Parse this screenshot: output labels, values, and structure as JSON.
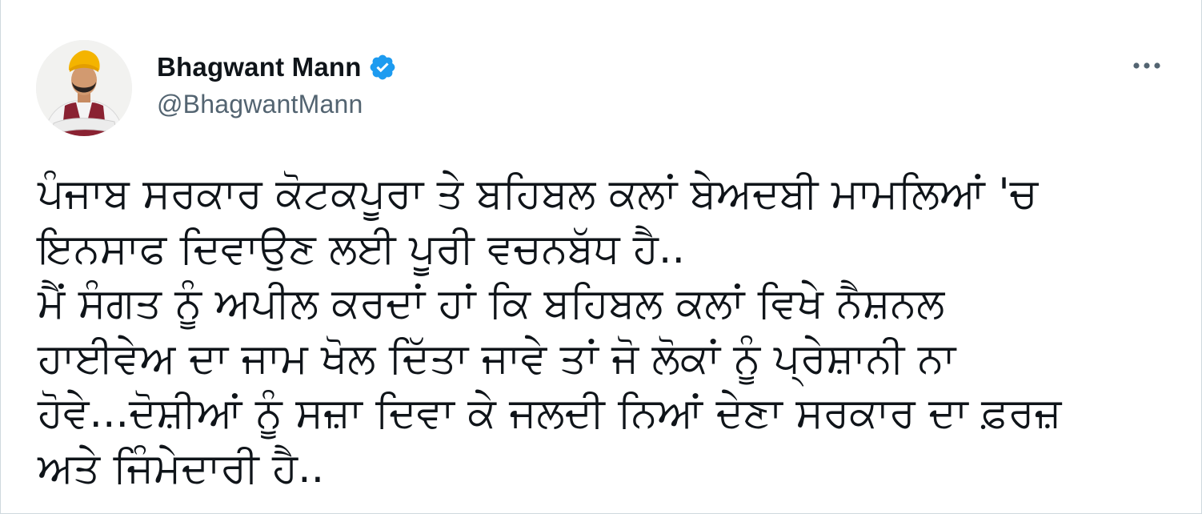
{
  "author": {
    "display_name": "Bhagwant Mann",
    "handle": "@BhagwantMann",
    "verified_icon": "verified-badge-icon",
    "verified_color": "#1d9bf0"
  },
  "menu": {
    "icon": "more-horizontal-icon"
  },
  "tweet": {
    "lines": [
      "ਪੰਜਾਬ ਸਰਕਾਰ ਕੋਟਕਪੂਰਾ ਤੇ ਬਹਿਬਲ ਕਲਾਂ ਬੇਅਦਬੀ ਮਾਮਲਿਆਂ 'ਚ",
      "ਇਨਸਾਫ ਦਿਵਾਉਣ ਲਈ ਪੂਰੀ ਵਚਨਬੱਧ ਹੈ..",
      "ਮੈਂ ਸੰਗਤ ਨੂੰ ਅਪੀਲ ਕਰਦਾਂ ਹਾਂ ਕਿ ਬਹਿਬਲ ਕਲਾਂ ਵਿਖੇ ਨੈਸ਼ਨਲ",
      "ਹਾਈਵੇਅ ਦਾ ਜਾਮ ਖੋਲ ਦਿੱਤਾ ਜਾਵੇ ਤਾਂ ਜੋ ਲੋਕਾਂ ਨੂੰ ਪ੍ਰੇਸ਼ਾਨੀ ਨਾ",
      "ਹੋਵੇ...ਦੋਸ਼ੀਆਂ ਨੂੰ ਸਜ਼ਾ ਦਿਵਾ ਕੇ ਜਲਦੀ ਨਿਆਂ ਦੇਣਾ ਸਰਕਾਰ ਦਾ ਫ਼ਰਜ਼",
      "ਅਤੇ ਜਿੰਮੇਦਾਰੀ ਹੈ.."
    ]
  }
}
